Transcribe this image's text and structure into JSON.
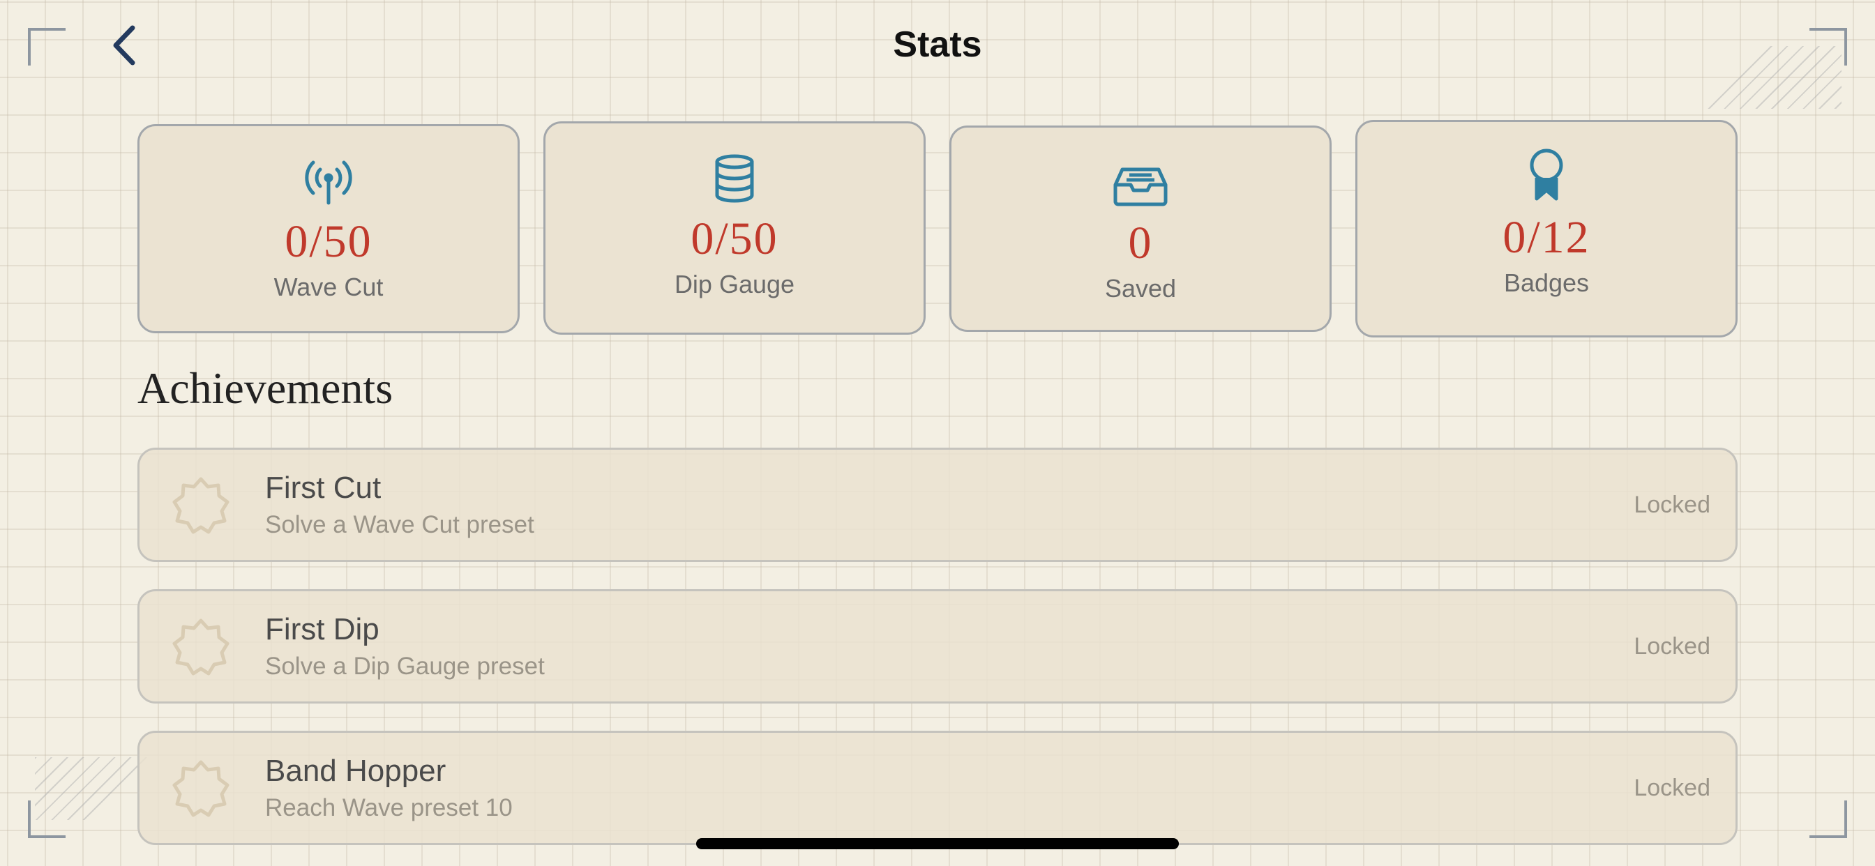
{
  "header": {
    "title": "Stats"
  },
  "stats": [
    {
      "icon": "antenna-icon",
      "value": "0/50",
      "label": "Wave Cut"
    },
    {
      "icon": "database-icon",
      "value": "0/50",
      "label": "Dip Gauge"
    },
    {
      "icon": "inbox-icon",
      "value": "0",
      "label": "Saved"
    },
    {
      "icon": "award-ribbon-icon",
      "value": "0/12",
      "label": "Badges"
    }
  ],
  "achievements": {
    "heading": "Achievements",
    "items": [
      {
        "icon": "badge-outline-icon",
        "title": "First Cut",
        "description": "Solve a Wave Cut preset",
        "status": "Locked"
      },
      {
        "icon": "badge-outline-icon",
        "title": "First Dip",
        "description": "Solve a Dip Gauge preset",
        "status": "Locked"
      },
      {
        "icon": "badge-outline-icon",
        "title": "Band Hopper",
        "description": "Reach Wave preset 10",
        "status": "Locked"
      }
    ]
  },
  "colors": {
    "accent": "#2f7fa1",
    "value": "#c0392b",
    "background": "#f3efe3",
    "card": "#ebe3d2"
  }
}
